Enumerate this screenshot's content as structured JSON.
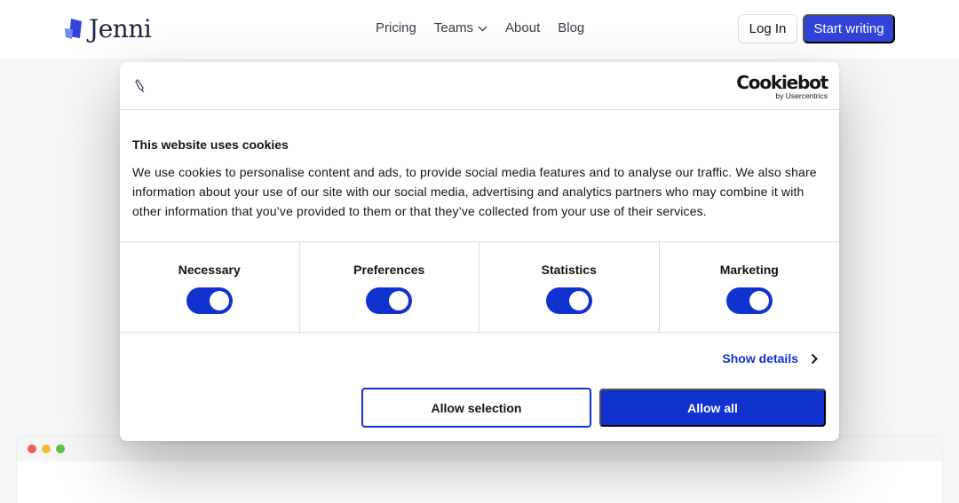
{
  "header": {
    "logo_text": "Jenni",
    "nav": [
      {
        "label": "Pricing"
      },
      {
        "label": "Teams"
      },
      {
        "label": "About"
      },
      {
        "label": "Blog"
      }
    ],
    "login_label": "Log In",
    "start_label": "Start writing"
  },
  "cookie_dialog": {
    "provider_logo_text": "Cookiebot",
    "provider_logo_sub": "by Usercentrics",
    "title": "This website uses cookies",
    "body": "We use cookies to personalise content and ads, to provide social media features and to analyse our traffic. We also share information about your use of our site with our social media, advertising and analytics partners who may combine it with other information that you’ve provided to them or that they’ve collected from your use of their services.",
    "categories": [
      {
        "label": "Necessary",
        "enabled": true
      },
      {
        "label": "Preferences",
        "enabled": true
      },
      {
        "label": "Statistics",
        "enabled": true
      },
      {
        "label": "Marketing",
        "enabled": true
      }
    ],
    "show_details_label": "Show details",
    "allow_selection_label": "Allow selection",
    "allow_all_label": "Allow all"
  },
  "icons": {
    "logo": "jenni-logo-icon",
    "teams_dropdown": "chevron-down-icon",
    "dialog_brand": "pen-icon",
    "show_details": "chevron-right-icon"
  },
  "colors": {
    "brand_primary": "#3142d6",
    "cookiebot_blue": "#1032cf",
    "window_dot_red": "#ec5f56",
    "window_dot_yellow": "#f2bd3c",
    "window_dot_green": "#5ec148"
  }
}
